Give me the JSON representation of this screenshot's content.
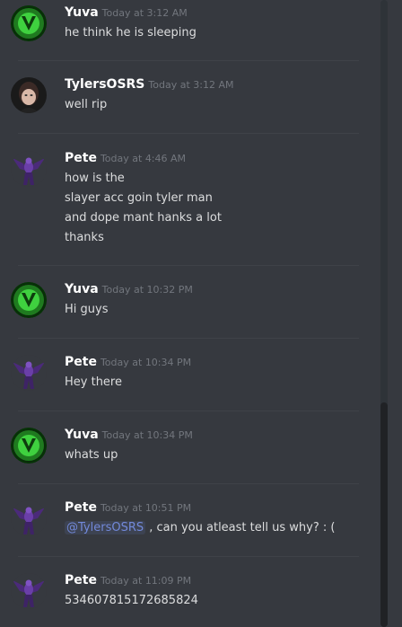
{
  "messages": [
    {
      "author": "Yuva",
      "timestamp": "Today at 3:12 AM",
      "lines": [
        "he think he is sleeping"
      ],
      "avatar": "green-avatar"
    },
    {
      "author": "TylersOSRS",
      "timestamp": "Today at 3:12 AM",
      "lines": [
        "well rip"
      ],
      "avatar": "photo-avatar"
    },
    {
      "author": "Pete",
      "timestamp": "Today at 4:46 AM",
      "lines": [
        "how is the",
        "slayer acc goin tyler man",
        "and dope mant hanks a lot",
        "thanks"
      ],
      "avatar": "purple-demon-avatar"
    },
    {
      "author": "Yuva",
      "timestamp": "Today at 10:32 PM",
      "lines": [
        "Hi guys"
      ],
      "avatar": "green-avatar"
    },
    {
      "author": "Pete",
      "timestamp": "Today at 10:34 PM",
      "lines": [
        "Hey there"
      ],
      "avatar": "purple-demon-avatar"
    },
    {
      "author": "Yuva",
      "timestamp": "Today at 10:34 PM",
      "lines": [
        "whats up"
      ],
      "avatar": "green-avatar"
    },
    {
      "author": "Pete",
      "timestamp": "Today at 10:51 PM",
      "mention": "@TylersOSRS",
      "lines": [
        " , can you atleast tell us why? : ("
      ],
      "avatar": "purple-demon-avatar"
    },
    {
      "author": "Pete",
      "timestamp": "Today at 11:09 PM",
      "lines": [
        "534607815172685824"
      ],
      "avatar": "purple-demon-avatar"
    }
  ],
  "colors": {
    "background": "#36393f",
    "username": "#ffffff",
    "timestamp": "#72767d",
    "text": "#dcddde",
    "mention": "#7289da"
  }
}
